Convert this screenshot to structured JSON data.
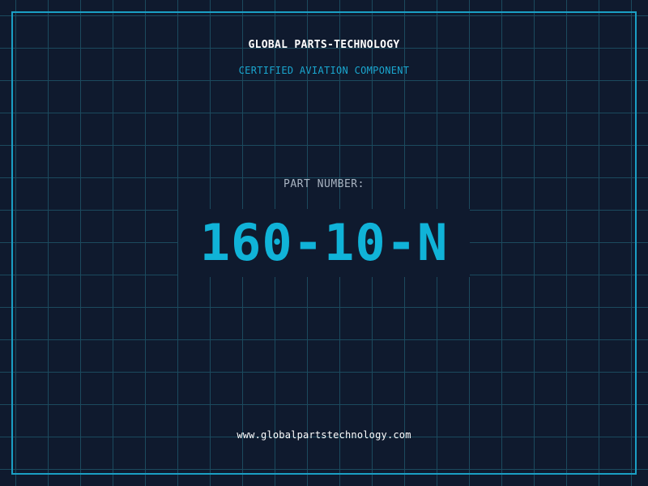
{
  "header": {
    "company": "GLOBAL PARTS-TECHNOLOGY",
    "subtitle": "CERTIFIED AVIATION COMPONENT"
  },
  "part": {
    "label": "PART NUMBER:",
    "number": "160-10-N"
  },
  "footer": {
    "url": "www.globalpartstechnology.com"
  },
  "colors": {
    "background": "#0f1a2e",
    "grid": "#1b4a5e",
    "accent": "#10b3d8",
    "frame": "#1a9fc4"
  }
}
